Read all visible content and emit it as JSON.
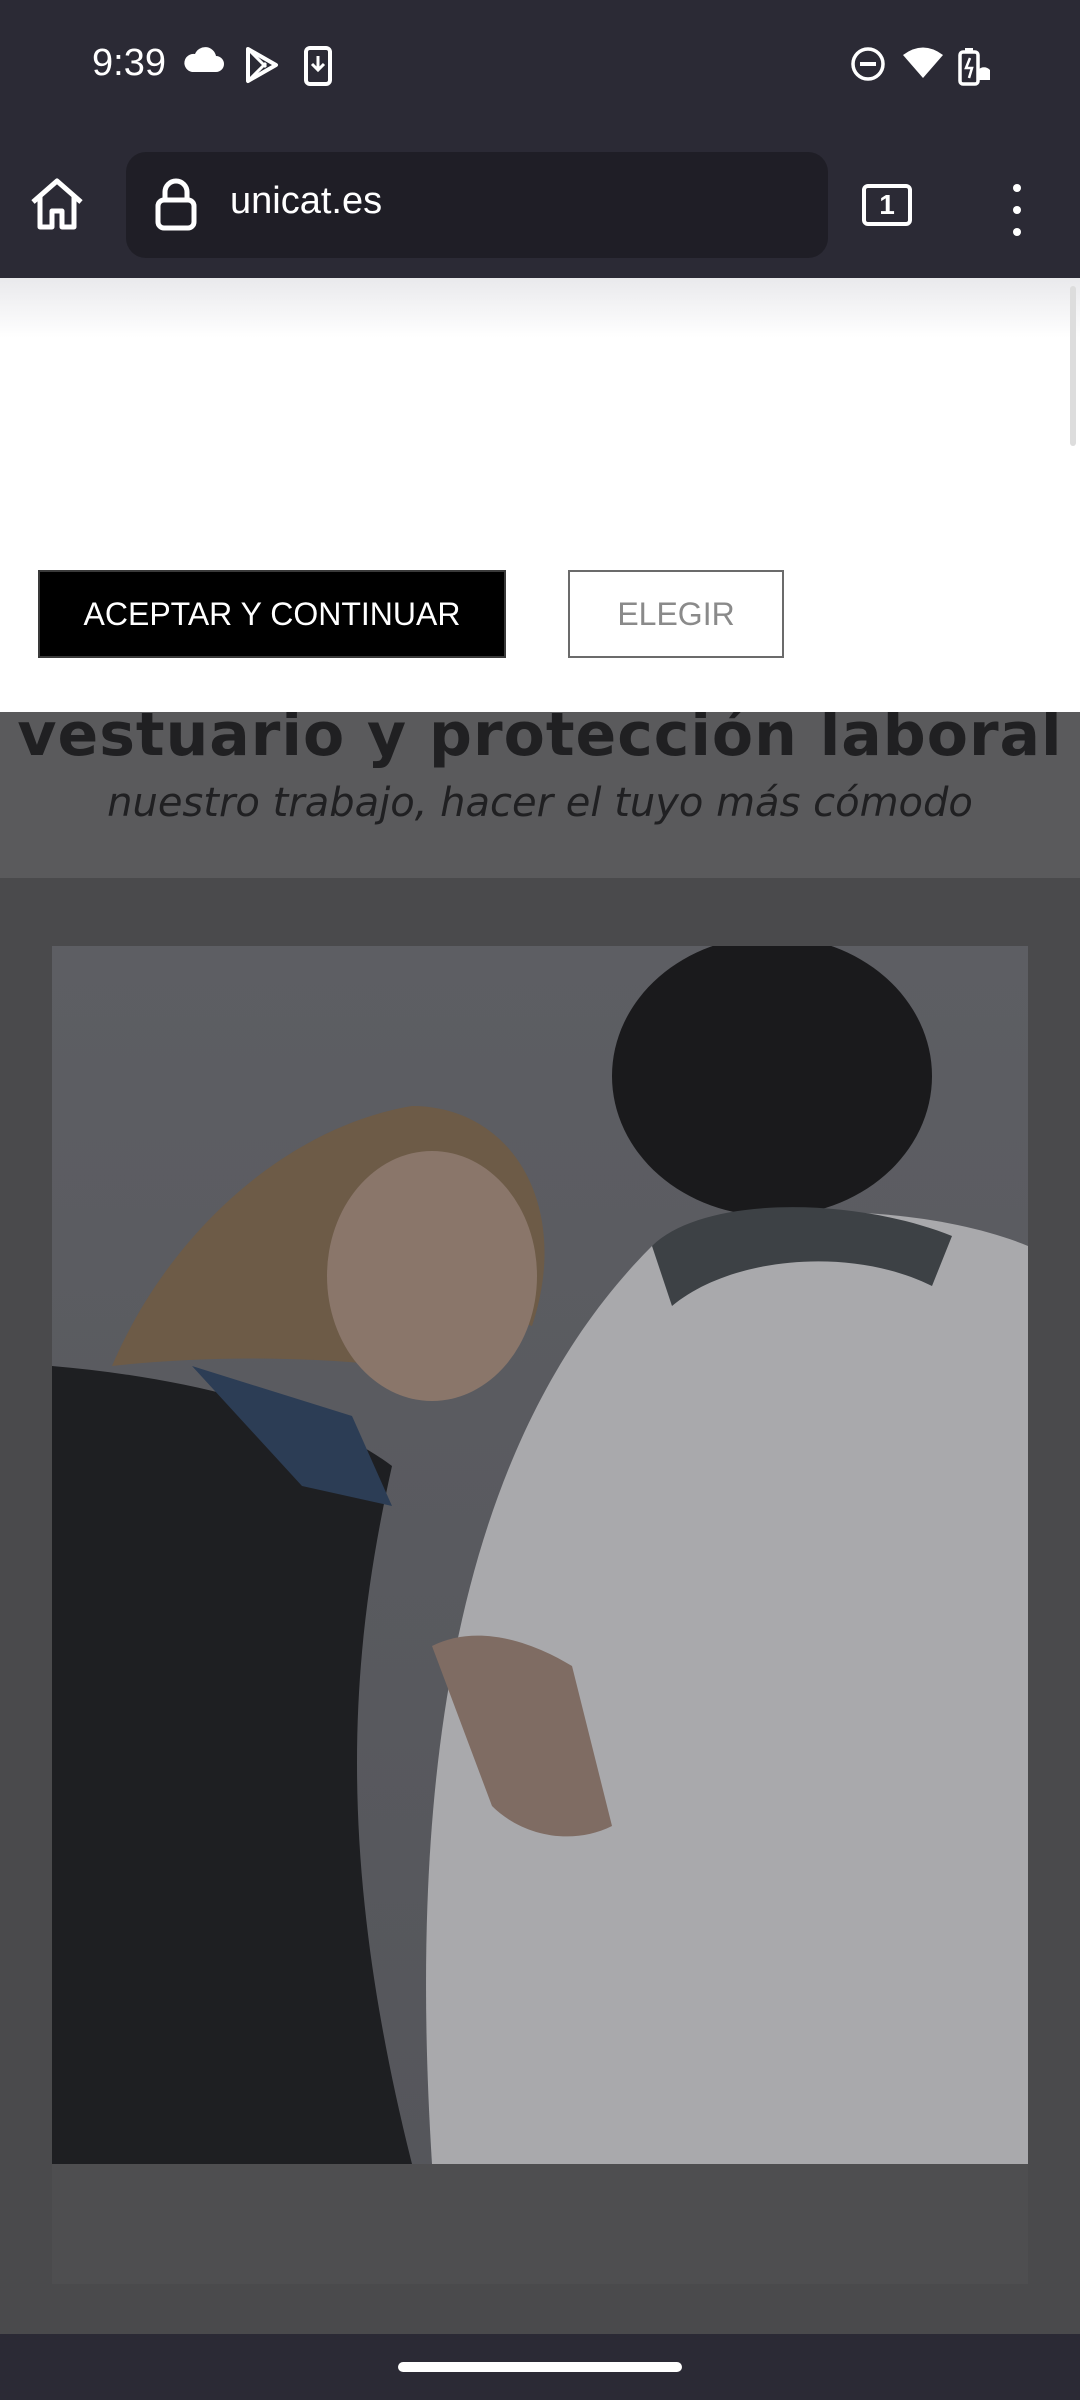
{
  "status_bar": {
    "time": "9:39",
    "left_icons": [
      "cloud-icon",
      "play-store-icon",
      "download-icon"
    ],
    "right_icons": [
      "dnd-icon",
      "wifi-icon",
      "battery-icon"
    ]
  },
  "browser": {
    "url": "unicat.es",
    "tab_count": "1"
  },
  "consent": {
    "accept_label": "ACEPTAR Y CONTINUAR",
    "choose_label": "ELEGIR"
  },
  "page": {
    "headline": "vestuario y protección laboral",
    "subheadline": "nuestro trabajo, hacer el tuyo más cómodo",
    "hero_image": "couple-hugging-photo"
  },
  "colors": {
    "system_bar": "#2b2a35",
    "accept_button": "#000000",
    "overlay_page": "#4a4a4c"
  }
}
